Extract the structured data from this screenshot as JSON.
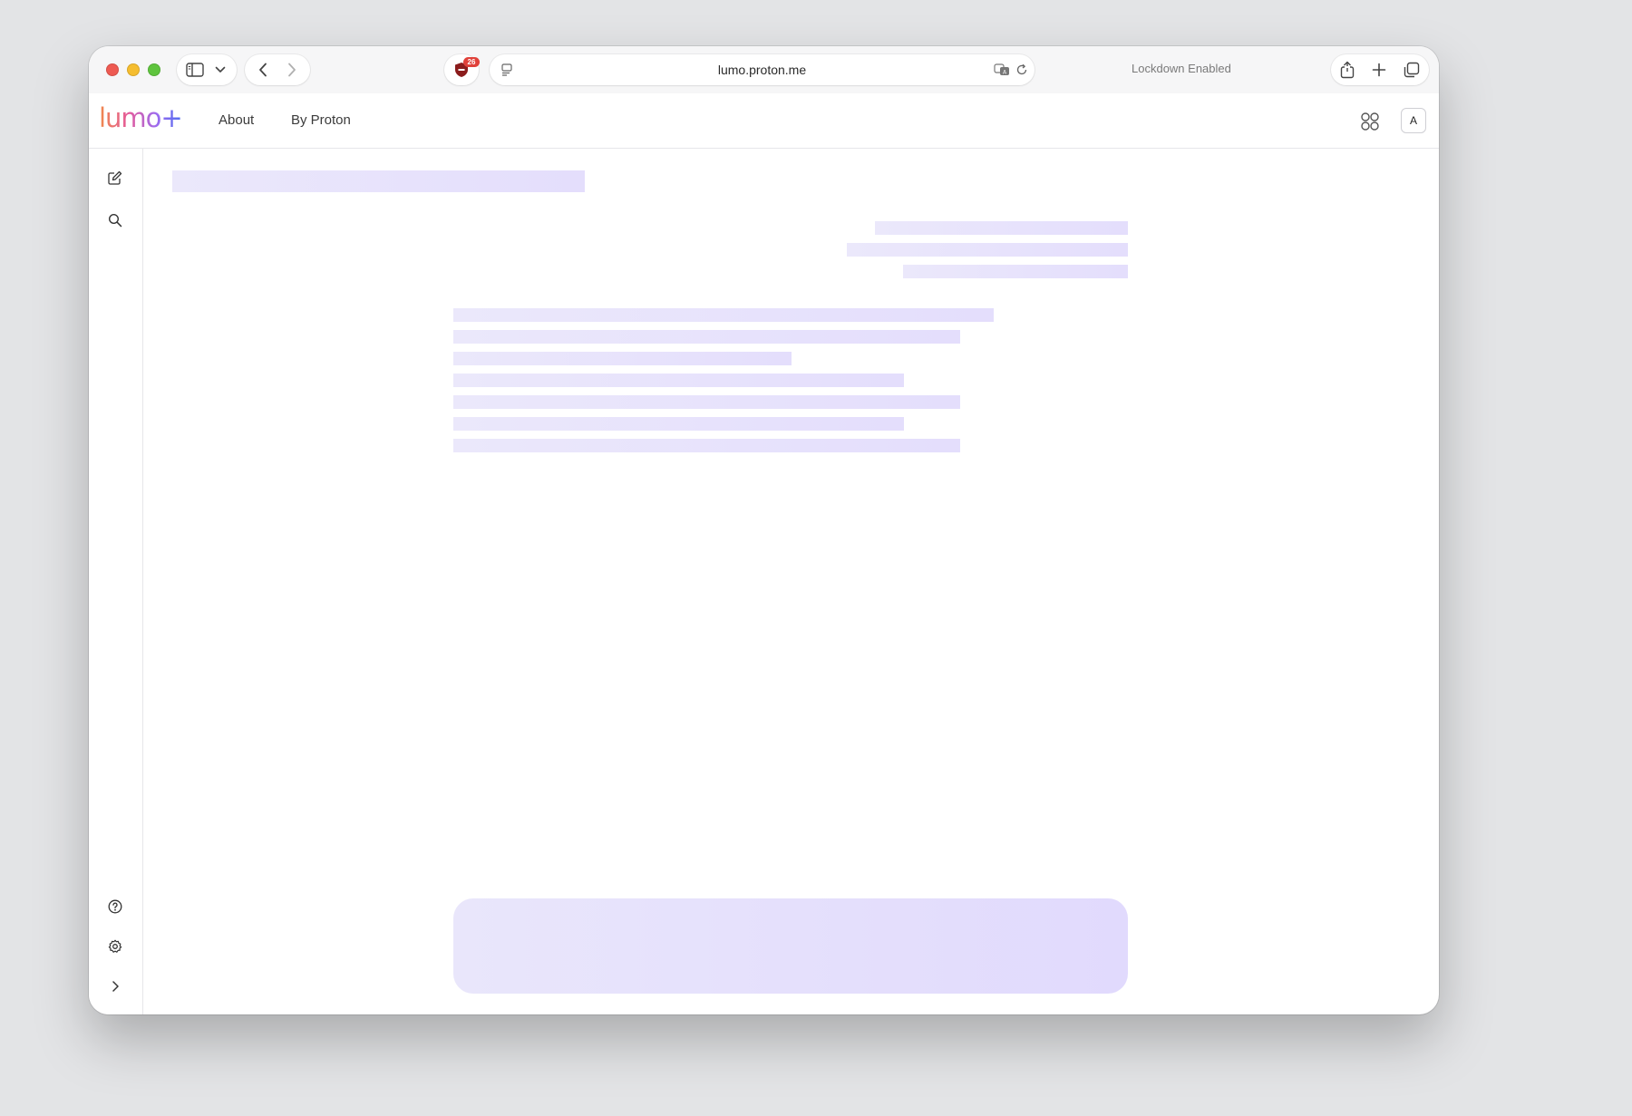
{
  "browser": {
    "url": "lumo.proton.me",
    "status_text": "Lockdown Enabled",
    "extension_badge_count": "26",
    "icons": [
      "sidebar-icon",
      "chevron-down-icon",
      "back-icon",
      "forward-icon",
      "shield-icon",
      "reader-icon",
      "translate-icon",
      "reload-icon",
      "share-icon",
      "new-tab-icon",
      "tabs-overview-icon"
    ]
  },
  "app": {
    "logo_text": "lumo+",
    "nav": {
      "about": "About",
      "by_proton": "By Proton"
    },
    "avatar_initial": "A",
    "rail_icons": [
      "new-chat-icon",
      "search-icon",
      "help-icon",
      "settings-icon",
      "expand-icon"
    ],
    "state": "loading-skeleton",
    "colors": {
      "skeleton": "#e8e4fb",
      "accent": "#6d4aff"
    }
  }
}
